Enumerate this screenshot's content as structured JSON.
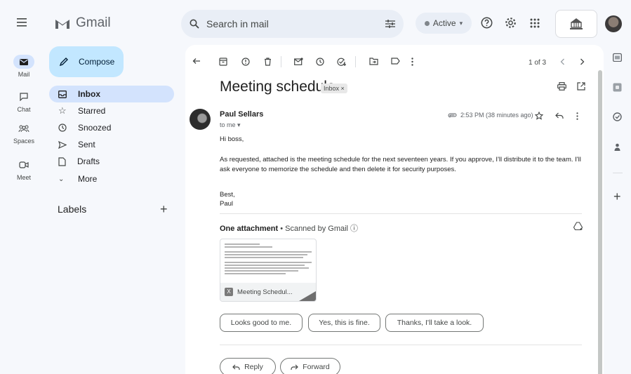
{
  "app": {
    "name": "Gmail"
  },
  "search": {
    "placeholder": "Search in mail"
  },
  "status": {
    "label": "Active"
  },
  "rail": [
    {
      "label": "Mail"
    },
    {
      "label": "Chat"
    },
    {
      "label": "Spaces"
    },
    {
      "label": "Meet"
    }
  ],
  "compose": {
    "label": "Compose"
  },
  "nav": [
    {
      "label": "Inbox"
    },
    {
      "label": "Starred"
    },
    {
      "label": "Snoozed"
    },
    {
      "label": "Sent"
    },
    {
      "label": "Drafts"
    },
    {
      "label": "More"
    }
  ],
  "labels": {
    "title": "Labels"
  },
  "toolbar": {
    "pager": "1 of 3"
  },
  "email": {
    "subject": "Meeting schedule",
    "label_chip": "Inbox ×",
    "sender": "Paul Sellars",
    "to": "to me ▾",
    "time": "2:53 PM (38 minutes ago)",
    "greeting": "Hi boss,",
    "body": "As requested, attached is the meeting schedule for the next seventeen years. If you approve, I'll distribute it to the team. I'll ask everyone to memorize the schedule and then delete it for security purposes.",
    "signoff": "Best,",
    "signature": "Paul"
  },
  "attachment": {
    "count_label": "One attachment",
    "scan_label": "• Scanned by Gmail ⓘ",
    "file_name": "Meeting Schedul..."
  },
  "smart_replies": [
    "Looks good to me.",
    "Yes, this is fine.",
    "Thanks, I'll take a look."
  ],
  "actions": {
    "reply": "Reply",
    "forward": "Forward"
  },
  "colors": {
    "selected": "#d3e3fd",
    "compose": "#c2e7ff",
    "background": "#f6f8fc"
  }
}
